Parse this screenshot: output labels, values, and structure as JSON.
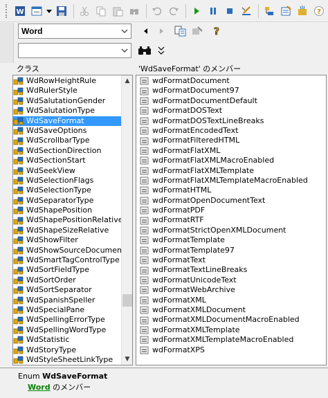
{
  "library_combo": {
    "value": "Word"
  },
  "search_combo": {
    "value": ""
  },
  "classes_header": "クラス",
  "members_header": "'WdSaveFormat' のメンバー",
  "classes": [
    "WdRowHeightRule",
    "WdRulerStyle",
    "WdSalutationGender",
    "WdSalutationType",
    "WdSaveFormat",
    "WdSaveOptions",
    "WdScrollbarType",
    "WdSectionDirection",
    "WdSectionStart",
    "WdSeekView",
    "WdSelectionFlags",
    "WdSelectionType",
    "WdSeparatorType",
    "WdShapePosition",
    "WdShapePositionRelative",
    "WdShapeSizeRelative",
    "WdShowFilter",
    "WdShowSourceDocuments",
    "WdSmartTagControlType",
    "WdSortFieldType",
    "WdSortOrder",
    "WdSortSeparator",
    "WdSpanishSpeller",
    "WdSpecialPane",
    "WdSpellingErrorType",
    "WdSpellingWordType",
    "WdStatistic",
    "WdStoryType",
    "WdStyleSheetLinkType"
  ],
  "selected_class": "WdSaveFormat",
  "members": [
    "wdFormatDocument",
    "wdFormatDocument97",
    "wdFormatDocumentDefault",
    "wdFormatDOSText",
    "wdFormatDOSTextLineBreaks",
    "wdFormatEncodedText",
    "wdFormatFilteredHTML",
    "wdFormatFlatXML",
    "wdFormatFlatXMLMacroEnabled",
    "wdFormatFlatXMLTemplate",
    "wdFormatFlatXMLTemplateMacroEnabled",
    "wdFormatHTML",
    "wdFormatOpenDocumentText",
    "wdFormatPDF",
    "wdFormatRTF",
    "wdFormatStrictOpenXMLDocument",
    "wdFormatTemplate",
    "wdFormatTemplate97",
    "wdFormatText",
    "wdFormatTextLineBreaks",
    "wdFormatUnicodeText",
    "wdFormatWebArchive",
    "wdFormatXML",
    "wdFormatXMLDocument",
    "wdFormatXMLDocumentMacroEnabled",
    "wdFormatXMLTemplate",
    "wdFormatXMLTemplateMacroEnabled",
    "wdFormatXPS"
  ],
  "details": {
    "enum_prefix": "Enum ",
    "enum_name": "WdSaveFormat",
    "library_link": "Word",
    "member_of": " のメンバー"
  },
  "colors": {
    "selection": "#3399ff",
    "link": "#008000"
  },
  "icons": {
    "toolbar": [
      "word-icon",
      "insert-userform-icon",
      "dropdown-icon",
      "save-icon",
      "cut-icon",
      "copy-icon",
      "paste-icon",
      "find-icon",
      "undo-icon",
      "redo-icon",
      "run-icon",
      "break-icon",
      "reset-icon",
      "design-mode-icon",
      "project-explorer-icon",
      "properties-icon",
      "object-browser-icon"
    ],
    "class_item": "enum-class-icon",
    "member_item": "enum-constant-icon"
  }
}
